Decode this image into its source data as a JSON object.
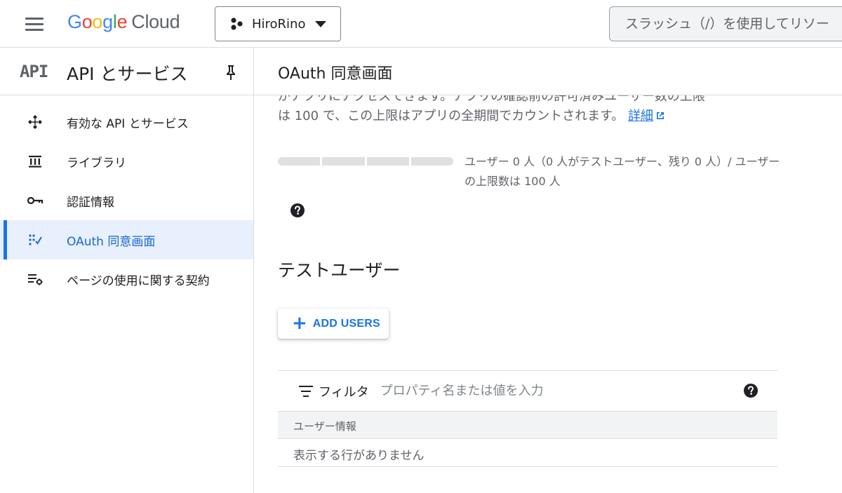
{
  "topbar": {
    "logo_google_letters": [
      {
        "char": "G",
        "color": "#4285F4"
      },
      {
        "char": "o",
        "color": "#EA4335"
      },
      {
        "char": "o",
        "color": "#FBBC04"
      },
      {
        "char": "g",
        "color": "#4285F4"
      },
      {
        "char": "l",
        "color": "#34A853"
      },
      {
        "char": "e",
        "color": "#EA4335"
      }
    ],
    "logo_cloud": "Cloud",
    "project_name": "HiroRino",
    "search_placeholder": "スラッシュ（/）を使用してリソー"
  },
  "sidebar": {
    "logo": "API",
    "title": "API とサービス",
    "items": [
      {
        "label": "有効な API とサービス",
        "icon": "api-nodes-icon",
        "active": false
      },
      {
        "label": "ライブラリ",
        "icon": "library-icon",
        "active": false
      },
      {
        "label": "認証情報",
        "icon": "key-icon",
        "active": false
      },
      {
        "label": "OAuth 同意画面",
        "icon": "oauth-consent-icon",
        "active": true
      },
      {
        "label": "ページの使用に関する契約",
        "icon": "settings-list-icon",
        "active": false
      }
    ]
  },
  "main": {
    "title": "OAuth 同意画面",
    "desc_line1": "がアプリにアクセスできます。アプリの確認前の許可済みユーザー数の上限",
    "desc_line2": "は 100 で、この上限はアプリの全期間でカウントされます。",
    "details_link": "詳細",
    "usage_text": "ユーザー 0 人（0 人がテストユーザー、残り 0 人）/ ユーザーの上限数は 100 人",
    "usage_fraction": 0,
    "section_title": "テストユーザー",
    "add_users_label": "ADD USERS",
    "filter_label": "フィルタ",
    "filter_placeholder": "プロパティ名または値を入力",
    "table_header": "ユーザー情報",
    "table_empty": "表示する行がありません"
  },
  "colors": {
    "accent": "#1a73e8",
    "active_bg": "#e8f0fe",
    "border": "#dadce0"
  }
}
